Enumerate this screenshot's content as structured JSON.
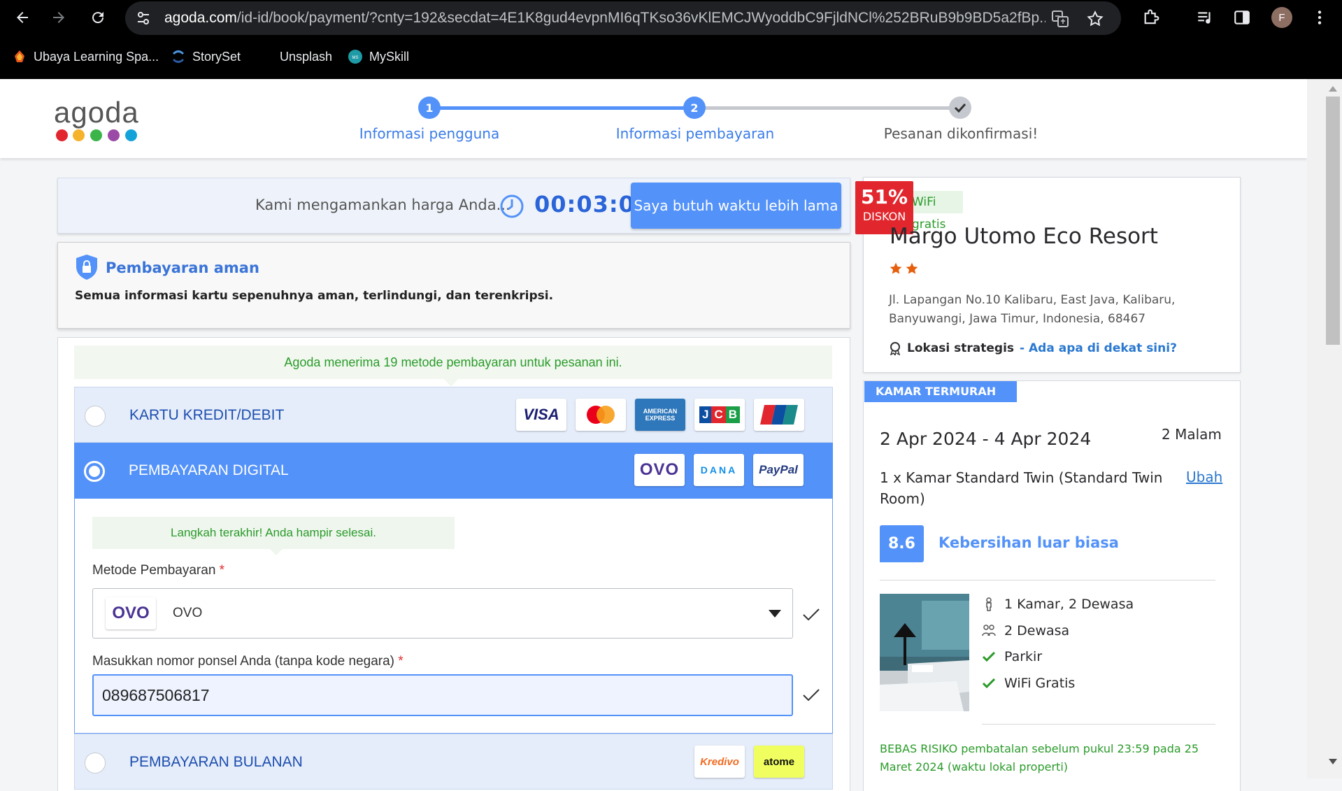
{
  "browser": {
    "url_host": "agoda.com",
    "url_path": "/id-id/book/payment/?cnty=192&secdat=4E1K8gud4evpnMI6qTKso36vKlEMCJWyoddbC9FjldNCl%252BRuB9b9BD5a2fBp...",
    "profile_initial": "F",
    "bookmarks": [
      {
        "label": "Ubaya Learning Spa..."
      },
      {
        "label": "StorySet"
      },
      {
        "label": "Unsplash"
      },
      {
        "label": "MySkill"
      }
    ]
  },
  "header": {
    "logo": "agoda",
    "logo_dot_colors": [
      "#e1262d",
      "#f5b32b",
      "#3bb54a",
      "#9b4ba5",
      "#14a3d9"
    ],
    "steps": [
      {
        "number": "1",
        "label": "Informasi pengguna",
        "state": "active"
      },
      {
        "number": "2",
        "label": "Informasi pembayaran",
        "state": "active"
      },
      {
        "number": "",
        "label": "Pesanan dikonfirmasi!",
        "state": "pending"
      }
    ],
    "accent_color": "#5392f9"
  },
  "timer": {
    "text": "Kami mengamankan harga Anda...",
    "value": "00:03:05",
    "button": "Saya butuh waktu lebih lama"
  },
  "secure": {
    "title": "Pembayaran aman",
    "description": "Semua informasi kartu sepenuhnya aman, terlindungi, dan terenkripsi."
  },
  "payment": {
    "accepted_text": "Agoda menerima 19 metode pembayaran untuk pesanan ini.",
    "options": [
      {
        "label": "KARTU KREDIT/DEBIT",
        "logos": [
          "VISA",
          "Mastercard",
          "AMERICAN EXPRESS",
          "JCB",
          "UnionPay"
        ],
        "selected": false
      },
      {
        "label": "PEMBAYARAN DIGITAL",
        "logos": [
          "OVO",
          "DANA",
          "PayPal"
        ],
        "selected": true
      },
      {
        "label": "PEMBAYARAN BULANAN",
        "logos": [
          "Kredivo",
          "atome"
        ],
        "selected": false
      }
    ],
    "digital": {
      "hint": "Langkah terakhir! Anda hampir selesai.",
      "method_label": "Metode Pembayaran",
      "method_value": "OVO",
      "phone_label": "Masukkan nomor ponsel Anda (tanpa kode negara)",
      "phone_value": "089687506817",
      "required_mark": "*"
    }
  },
  "hotel": {
    "discount_percent": "51%",
    "discount_label": "DISKON",
    "wifi_tag": "WiFi gratis",
    "name": "Margo Utomo Eco Resort",
    "stars": 2,
    "address": "Jl. Lapangan No.10 Kalibaru, East Java, Kalibaru, Banyuwangi, Jawa Timur, Indonesia, 68467",
    "location_label": "Lokasi strategis",
    "location_link": "- Ada apa di dekat sini?"
  },
  "room": {
    "tag": "KAMAR TERMURAH",
    "dates": "2 Apr 2024 - 4 Apr 2024",
    "nights": "2 Malam",
    "type": "1 x Kamar Standard Twin (Standard Twin Room)",
    "change": "Ubah",
    "score": "8.6",
    "score_label": "Kebersihan luar biasa",
    "amenities": [
      {
        "icon": "person-icon",
        "label": "1 Kamar, 2 Dewasa"
      },
      {
        "icon": "people-icon",
        "label": "2 Dewasa"
      },
      {
        "icon": "check-icon",
        "label": "Parkir"
      },
      {
        "icon": "check-icon",
        "label": "WiFi Gratis"
      }
    ],
    "cancellation": "BEBAS RISIKO pembatalan sebelum pukul 23:59 pada 25 Maret 2024 (waktu lokal properti)"
  }
}
